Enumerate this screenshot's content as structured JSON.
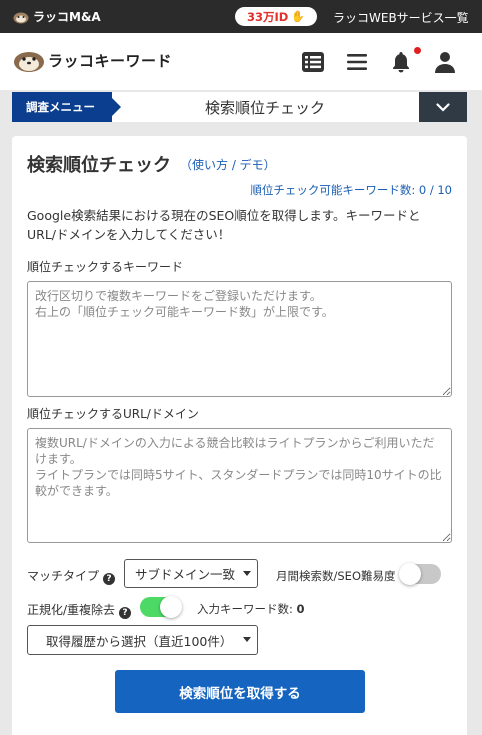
{
  "topbar": {
    "brand": "ラッコM&A",
    "pill": "33万ID",
    "services": "ラッコWEBサービス一覧"
  },
  "header": {
    "logo_text": "ラッコキーワード",
    "icons": [
      "list-icon",
      "menu-icon",
      "bell-icon",
      "user-icon"
    ]
  },
  "menubar": {
    "tag": "調査メニュー",
    "title": "検索順位チェック"
  },
  "card": {
    "title": "検索順位チェック",
    "howto": "（使い方 / デモ）",
    "quota": "順位チェック可能キーワード数: 0 / 10",
    "description": "Google検索結果における現在のSEO順位を取得します。キーワードとURL/ドメインを入力してください！",
    "keyword_label": "順位チェックするキーワード",
    "keyword_placeholder": "改行区切りで複数キーワードをご登録いただけます。\n右上の「順位チェック可能キーワード数」が上限です。",
    "url_label": "順位チェックするURL/ドメイン",
    "url_placeholder": "複数URL/ドメインの入力による競合比較はライトプランからご利用いただけます。\nライトプランでは同時5サイト、スタンダードプランでは同時10サイトの比較ができます。",
    "match_label": "マッチタイプ",
    "match_value": "サブドメイン一致",
    "volume_label": "月間検索数/SEO難易度",
    "normalize_label": "正規化/重複除去",
    "count_label": "入力キーワード数: ",
    "count_value": "0",
    "history_select": "取得履歴から選択（直近100件）",
    "submit": "検索順位を取得する"
  },
  "colors": {
    "accent": "#1565c0",
    "menu_tag": "#0b3e8f",
    "toggle_on": "#4cd964",
    "topbar": "#2b2b2b"
  }
}
